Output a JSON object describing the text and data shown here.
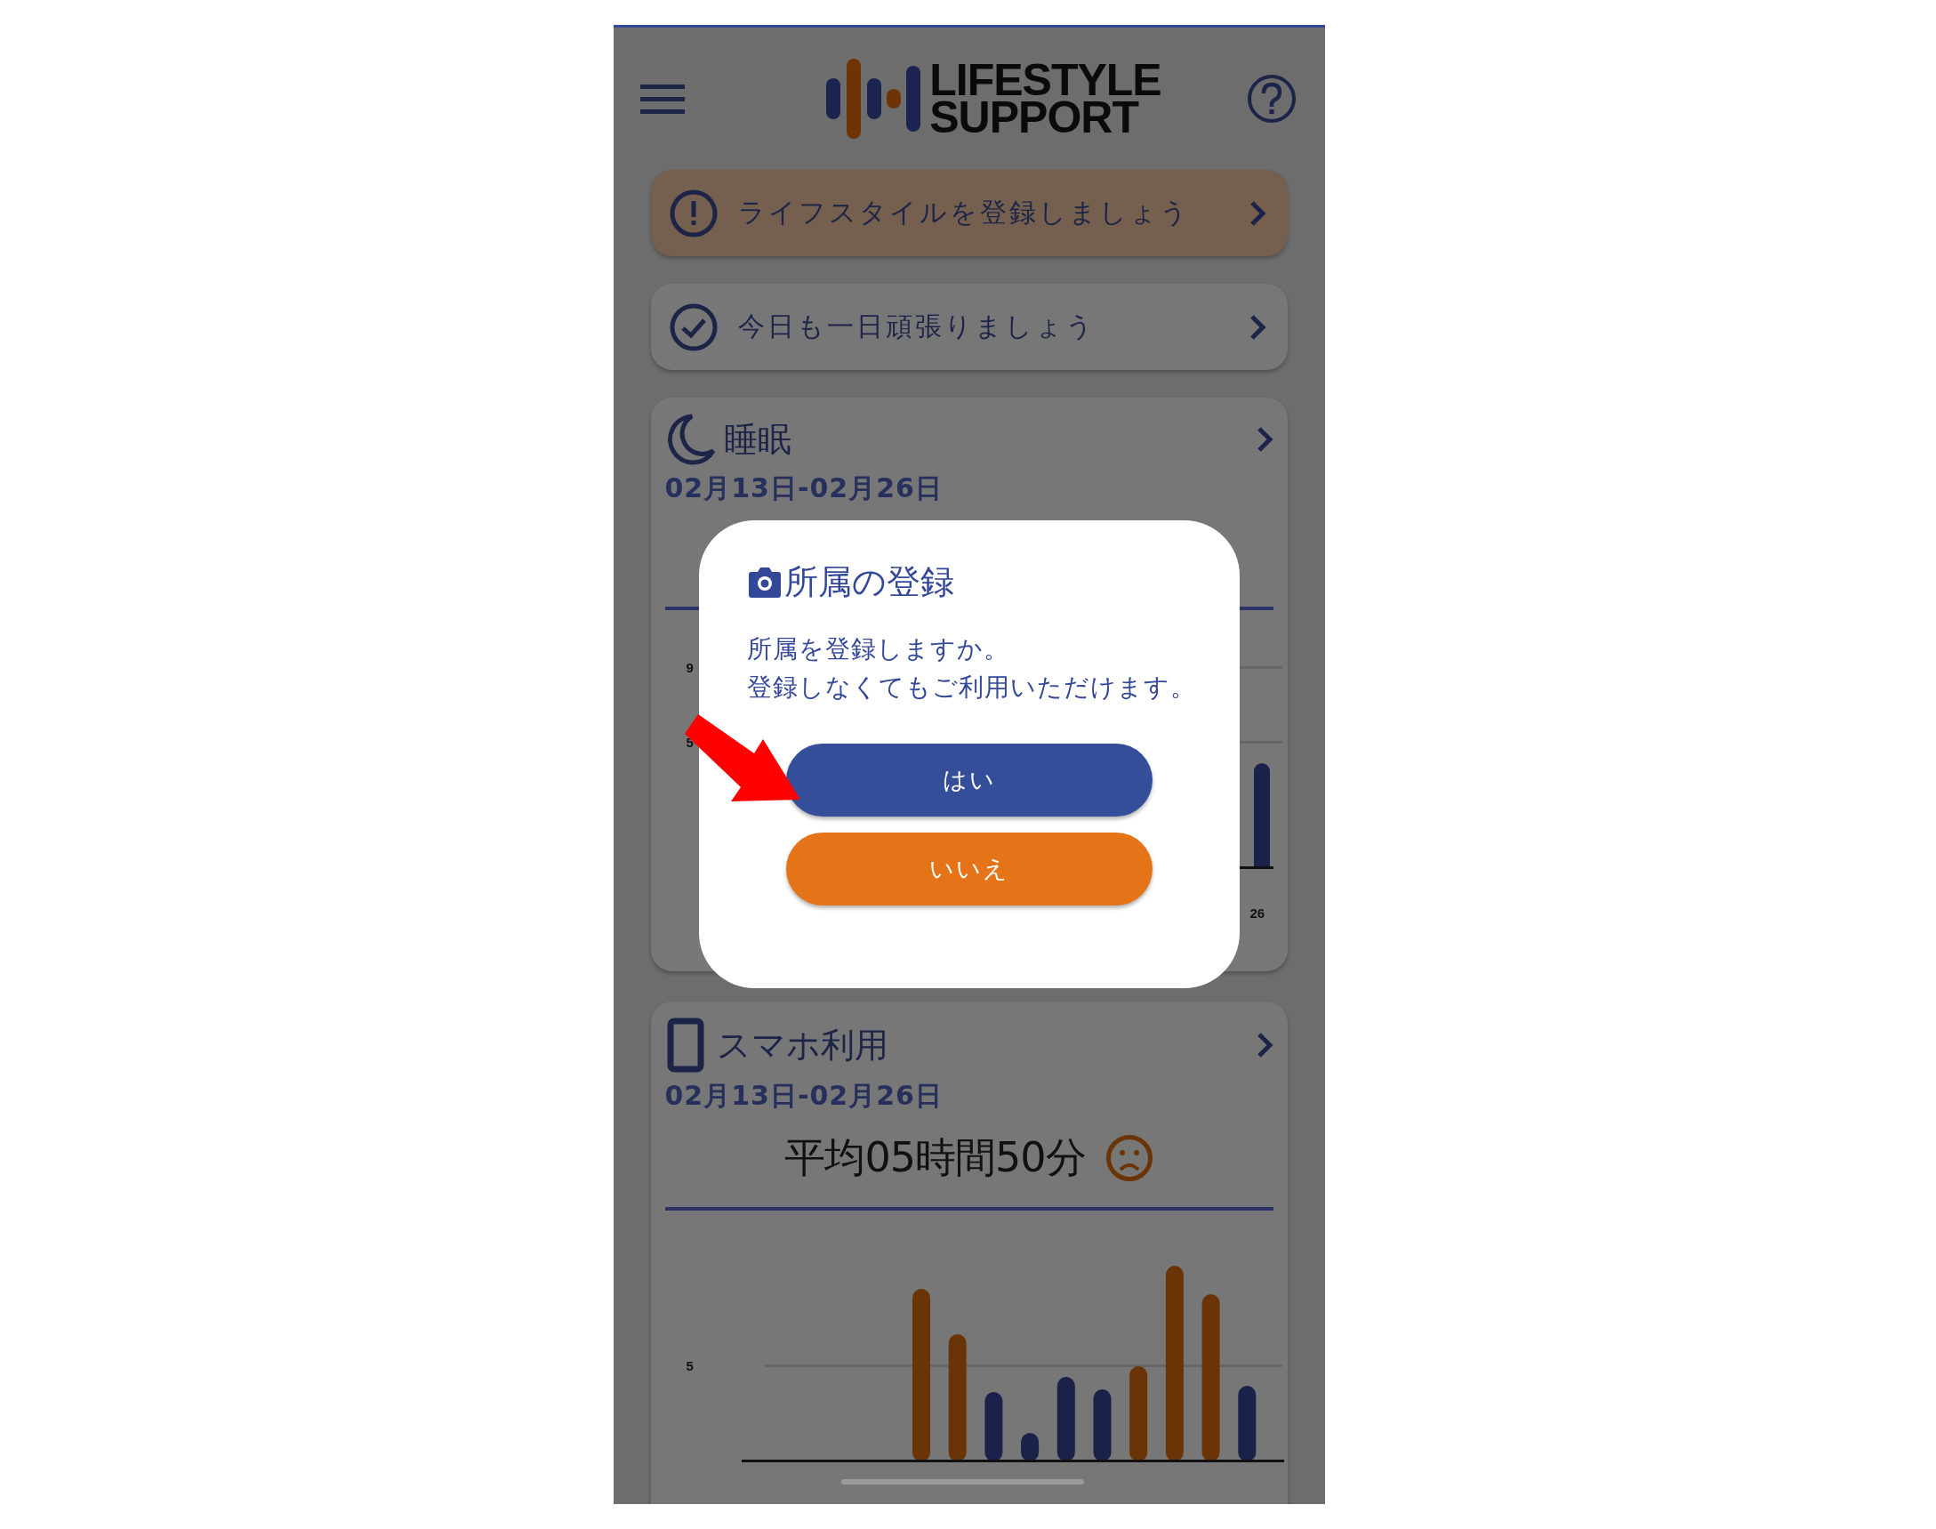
{
  "header": {
    "logo_lines": [
      "LIFESTYLE",
      "SUPPORT"
    ]
  },
  "notices": [
    {
      "kind": "warning",
      "text": "ライフスタイルを登録しましょう"
    },
    {
      "kind": "done",
      "text": "今日も一日頑張りましょう"
    }
  ],
  "sleep": {
    "title": "睡眠",
    "date_range": "02月13日-02月26日",
    "y_ticks": [
      "9",
      "5"
    ],
    "x_label": "26"
  },
  "phone_usage": {
    "title": "スマホ利用",
    "date_range": "02月13日-02月26日",
    "average": "平均05時間50分",
    "happy": false,
    "y_tick": "5"
  },
  "dialog": {
    "title": "所属の登録",
    "message": [
      "所属を登録しますか。",
      "登録しなくてもご利用いただけます。"
    ],
    "buttons": [
      {
        "label": "はい",
        "kind": "primary"
      },
      {
        "label": "いいえ",
        "kind": "secondary"
      }
    ]
  }
}
